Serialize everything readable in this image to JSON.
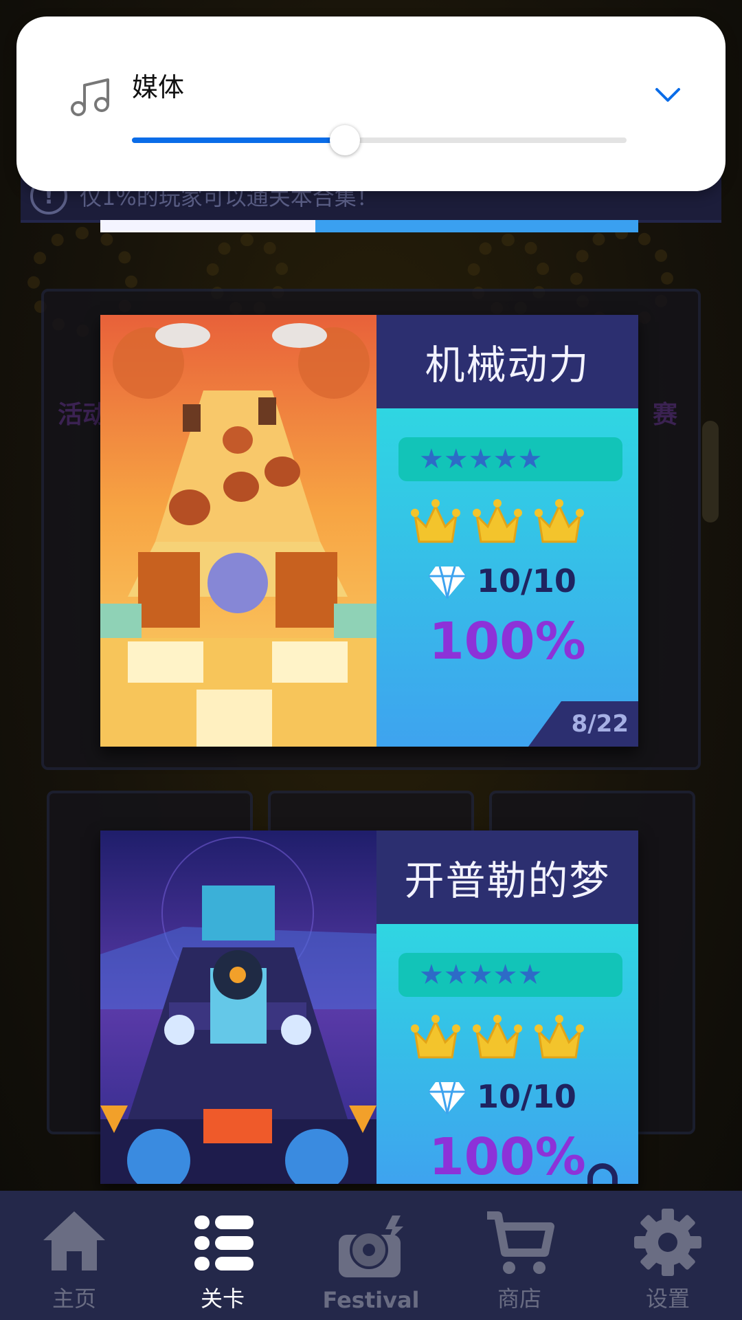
{
  "notice": {
    "text": "仅1%的玩家可以通关本合集！",
    "icon": "exclamation-icon"
  },
  "volume_panel": {
    "label": "媒体",
    "level_percent": 43,
    "icon": "music-note-icon",
    "collapse_icon": "chevron-down-icon",
    "accent_color": "#0a6ce8"
  },
  "levels": [
    {
      "title": "机械动力",
      "stars": "★★★★★",
      "crowns": 3,
      "gems": "10/10",
      "percent": "100%",
      "progress": "8/22"
    },
    {
      "title": "开普勒的梦",
      "stars": "★★★★★",
      "crowns": 3,
      "gems": "10/10",
      "percent": "100%"
    }
  ],
  "background": {
    "left_text": "活动",
    "right_text": "赛"
  },
  "nav": {
    "items": [
      {
        "label": "主页",
        "icon": "home-icon",
        "active": false
      },
      {
        "label": "关卡",
        "icon": "list-icon",
        "active": true
      },
      {
        "label": "Festival",
        "icon": "festival-record-icon",
        "active": false
      },
      {
        "label": "商店",
        "icon": "cart-icon",
        "active": false
      },
      {
        "label": "设置",
        "icon": "gear-icon",
        "active": false
      }
    ]
  }
}
